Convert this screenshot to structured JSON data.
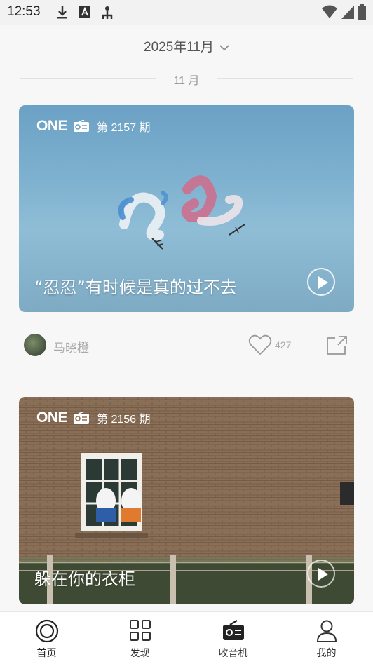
{
  "status_bar": {
    "time": "12:53",
    "icons": [
      "download-icon",
      "a-icon",
      "tree-icon",
      "wifi-icon",
      "signal-icon",
      "battery-icon"
    ]
  },
  "header": {
    "month_title": "2025年11月",
    "section_label": "11 月"
  },
  "cards": [
    {
      "brand": "ONE",
      "issue": "第 2157 期",
      "title": "“忍忍”有时候是真的过不去",
      "author": "马晓橙",
      "likes": "427"
    },
    {
      "brand": "ONE",
      "issue": "第 2156 期",
      "title": "躲在你的衣柜"
    }
  ],
  "tabs": [
    {
      "label": "首页",
      "icon": "home-icon"
    },
    {
      "label": "发现",
      "icon": "grid-icon"
    },
    {
      "label": "收音机",
      "icon": "radio-icon"
    },
    {
      "label": "我的",
      "icon": "person-icon"
    }
  ],
  "colors": {
    "background": "#f7f7f7",
    "tab_bar": "#ffffff",
    "muted_text": "#aaaaaa"
  }
}
